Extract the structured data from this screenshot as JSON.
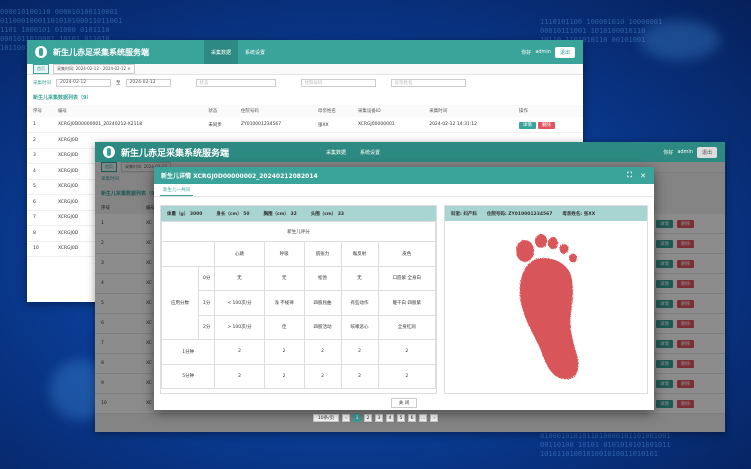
{
  "bg": {
    "bits_rows": [
      "000010100110 000010100110001",
      "01100010001101010100011011001",
      "1101 1000101 01000 0101110",
      "0001011010001 10101 011010",
      "1011001010 0010101 10100011"
    ],
    "bits_right": [
      "1110101100 100001010 10000001",
      "00010111001 1010100010110",
      "10110 1101010110 00101001"
    ],
    "bits_bottom": [
      "0100010101011010000101101001001",
      "00110100 10101 0101010101001011",
      "1010110100101001010011010101"
    ]
  },
  "w1": {
    "title": "新生儿赤足采集系统服务端",
    "nav": [
      "采集数据",
      "系统设置"
    ],
    "user": "admin",
    "user_label": "你好",
    "logout": "退出",
    "tags": [
      "首页",
      "采集时间: 2024-02-12 - 2024-02-12 ×"
    ],
    "filters": {
      "time_label": "采集时间",
      "start": "2024-02-12",
      "to": "至",
      "end": "2024-02-12",
      "status_ph": "状态",
      "card_ph": "住院号码",
      "name_ph": "母亲姓名"
    },
    "section": "新生儿采集数据列表（9）",
    "headers": [
      "序号",
      "编号",
      "状态",
      "住院号码",
      "母亲姓名",
      "采集设备ID",
      "采集时间",
      "操作"
    ],
    "rows": [
      [
        "1",
        "XCRGJ0D00000001_20240212-X2118",
        "未同步",
        "ZY010001234567",
        "张XX",
        "XCRGJ00000001",
        "2024-02-12 14:31:12"
      ],
      [
        "2",
        "XCRGJ0D",
        "",
        "",
        "",
        "",
        ""
      ],
      [
        "3",
        "XCRGJ0D",
        "",
        "",
        "",
        "",
        ""
      ],
      [
        "4",
        "XCRGJ0D",
        "",
        "",
        "",
        "",
        ""
      ],
      [
        "5",
        "XCRGJ0D",
        "",
        "",
        "",
        "",
        ""
      ],
      [
        "6",
        "XCRGJ0D",
        "",
        "",
        "",
        "",
        ""
      ],
      [
        "7",
        "XCRGJ0D",
        "",
        "",
        "",
        "",
        ""
      ],
      [
        "8",
        "XCRGJ0D",
        "",
        "",
        "",
        "",
        ""
      ],
      [
        "10",
        "XCRGJ0D",
        "",
        "",
        "",
        "",
        ""
      ]
    ],
    "btn_detail": "详情",
    "btn_delete": "删除"
  },
  "w2": {
    "title": "新生儿赤足采集系统服务端",
    "nav": [
      "采集数据",
      "系统设置"
    ],
    "user": "admin",
    "user_label": "你好",
    "logout": "退出",
    "tags": [
      "首页",
      "采集时间: 2024-02-12"
    ],
    "section": "新生儿采集数据列表（9）",
    "filter_label": "采集时间",
    "col_num": "序号",
    "col_code": "编号",
    "col_op": "操作",
    "row_nums": [
      "1",
      "2",
      "3",
      "4",
      "5",
      "6",
      "7",
      "8",
      "9",
      "10"
    ],
    "code_prefix": "XC",
    "btn_detail": "详情",
    "btn_delete": "删除",
    "page_size": "10条/页",
    "pages": [
      "1",
      "2",
      "3",
      "4",
      "5",
      "6"
    ],
    "prev": "‹",
    "next": "›",
    "page_ellipsis": "..."
  },
  "modal": {
    "title": "新生儿详情 XCRGJ0D00000002_20240212082014",
    "tab": "新生儿一共同",
    "info": [
      {
        "k": "体重（g）",
        "v": "3000"
      },
      {
        "k": "身长（cm）",
        "v": "50"
      },
      {
        "k": "胸围（cm）",
        "v": "32"
      },
      {
        "k": "头围（cm）",
        "v": "33"
      }
    ],
    "mother": [
      {
        "k": "科室",
        "v": "妇产科"
      },
      {
        "k": "住院号码",
        "v": "ZY010001234567"
      },
      {
        "k": "母亲姓名",
        "v": "张XX"
      }
    ],
    "apgar_title": "新生儿评分",
    "apgar_cols": [
      "心跳",
      "呼吸",
      "肌张力",
      "喉反射",
      "皮色"
    ],
    "apgar_group": "应用分数",
    "apgar_rows": [
      {
        "score": "0分",
        "v": [
          "无",
          "无",
          "松弛",
          "无",
          "口唇紫 全身白"
        ]
      },
      {
        "score": "1分",
        "v": [
          "< 100次/分",
          "浅 不规律",
          "四肢屈曲",
          "有些动作",
          "躯干白 四肢紫"
        ]
      },
      {
        "score": "2分",
        "v": [
          "> 100次/分",
          "佳",
          "四肢活动",
          "咳嗽恶心",
          "全身红润"
        ]
      }
    ],
    "minute_rows": [
      {
        "label": "1分钟",
        "v": [
          "2",
          "2",
          "2",
          "2",
          "2"
        ]
      },
      {
        "label": "5分钟",
        "v": [
          "2",
          "2",
          "2",
          "2",
          "2"
        ]
      }
    ],
    "close": "关 闭"
  }
}
